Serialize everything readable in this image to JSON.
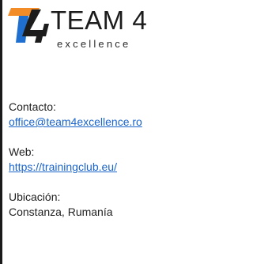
{
  "brand": {
    "name": "TEAM 4",
    "tagline": "excellence",
    "mark_digit": "4",
    "colors": {
      "orange": "#f28c28",
      "blue": "#1e6fd0",
      "dark": "#1c1c1c"
    }
  },
  "contact": {
    "label": "Contacto:",
    "email": "office@team4excellence.ro"
  },
  "web": {
    "label": "Web:",
    "url": "https://trainingclub.eu/"
  },
  "location": {
    "label": "Ubicación:",
    "value": "Constanza, Rumanía"
  },
  "colors": {
    "link": "#1b64c9",
    "text": "#222222"
  }
}
